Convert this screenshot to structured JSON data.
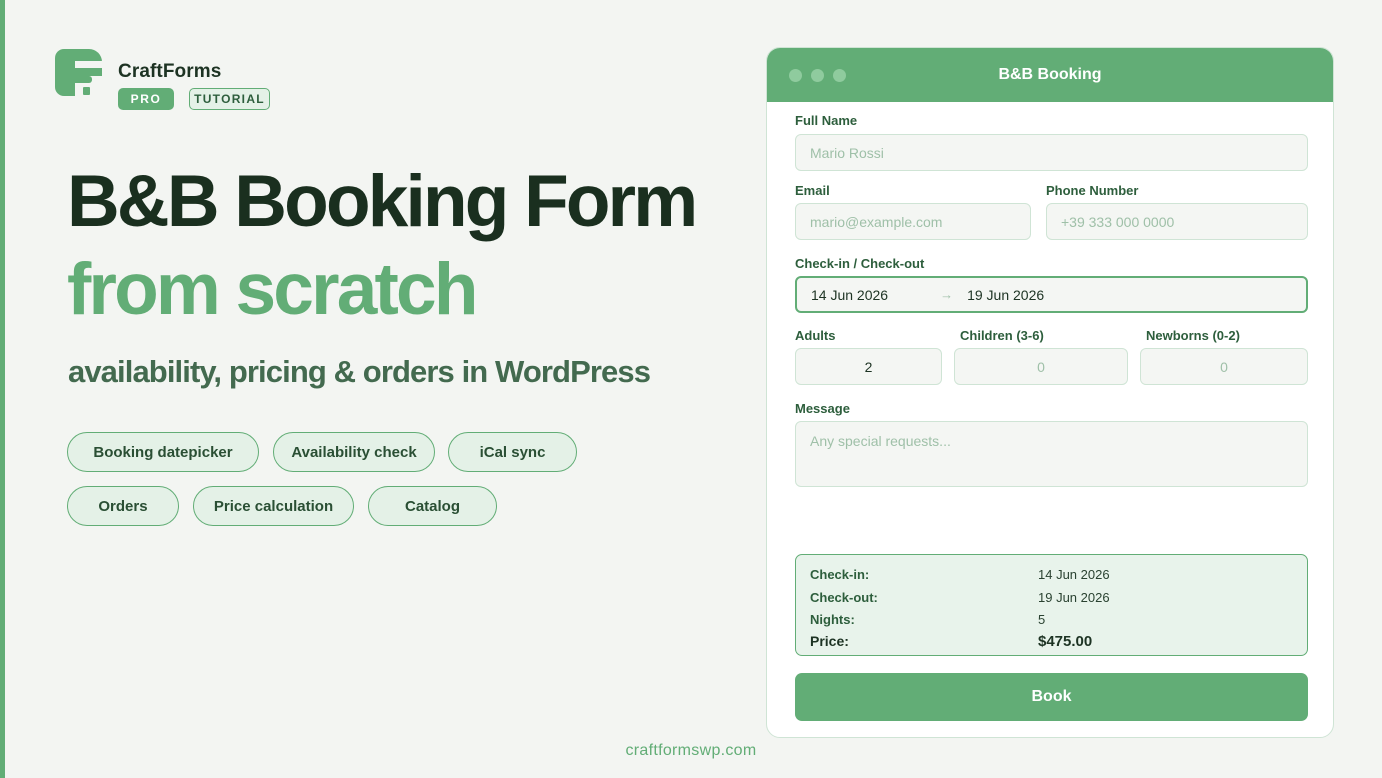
{
  "brand": {
    "name": "CraftForms",
    "badge_pro": "PRO",
    "badge_tutorial": "TUTORIAL"
  },
  "hero": {
    "title_line1": "B&B Booking Form",
    "title_line2": "from scratch",
    "subtitle": "availability, pricing & orders in WordPress"
  },
  "features": [
    "Booking datepicker",
    "Availability check",
    "iCal sync",
    "Orders",
    "Price calculation",
    "Catalog"
  ],
  "footer": {
    "url": "craftformswp.com"
  },
  "window": {
    "title": "B&B Booking"
  },
  "form": {
    "full_name": {
      "label": "Full Name",
      "placeholder": "Mario Rossi"
    },
    "email": {
      "label": "Email",
      "placeholder": "mario@example.com"
    },
    "phone": {
      "label": "Phone Number",
      "placeholder": "+39 333 000 0000"
    },
    "dates": {
      "label": "Check-in / Check-out",
      "checkin": "14 Jun 2026",
      "arrow": "→",
      "checkout": "19 Jun 2026"
    },
    "adults": {
      "label": "Adults",
      "value": "2"
    },
    "children": {
      "label": "Children (3-6)",
      "value": "0"
    },
    "newborns": {
      "label": "Newborns (0-2)",
      "value": "0"
    },
    "message": {
      "label": "Message",
      "placeholder": "Any special requests..."
    },
    "summary": {
      "checkin_label": "Check-in:",
      "checkin_value": "14 Jun 2026",
      "checkout_label": "Check-out:",
      "checkout_value": "19 Jun 2026",
      "nights_label": "Nights:",
      "nights_value": "5",
      "price_label": "Price:",
      "price_value": "$475.00"
    },
    "book_label": "Book"
  },
  "colors": {
    "accent": "#62ad76",
    "dark_text": "#1a2f1f",
    "background": "#f3f5f2"
  }
}
